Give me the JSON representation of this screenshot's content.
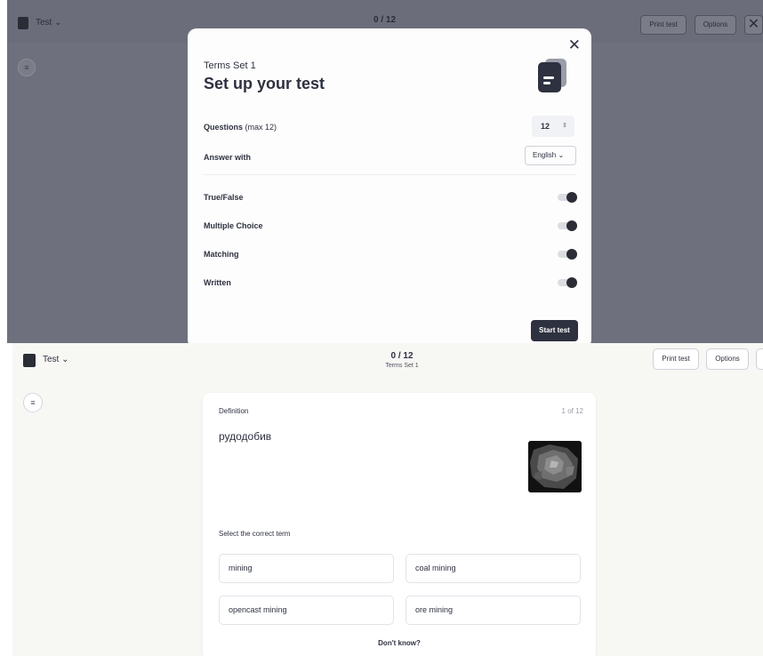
{
  "top": {
    "header": {
      "app_label": "Test ⌄",
      "counter": "0 / 12",
      "print_label": "Print test",
      "options_label": "Options",
      "close_glyph": "✕"
    },
    "modal": {
      "close_glyph": "✕",
      "set_name": "Terms Set 1",
      "title": "Set up your test",
      "questions_label": "Questions",
      "questions_hint": "(max 12)",
      "questions_value": "12",
      "answer_with_label": "Answer with",
      "answer_with_value": "English ⌄",
      "toggles": [
        {
          "label": "True/False",
          "on": true
        },
        {
          "label": "Multiple Choice",
          "on": true
        },
        {
          "label": "Matching",
          "on": true
        },
        {
          "label": "Written",
          "on": true
        }
      ],
      "start_label": "Start test"
    }
  },
  "bottom": {
    "header": {
      "app_label": "Test ⌄",
      "counter": "0 / 12",
      "set_name": "Terms Set 1",
      "print_label": "Print test",
      "options_label": "Options"
    },
    "card": {
      "label": "Definition",
      "progress": "1 of 12",
      "definition": "рудодобив",
      "select_label": "Select the correct term",
      "options": [
        "mining",
        "coal mining",
        "opencast mining",
        "ore mining"
      ],
      "dont_know": "Don't know?"
    }
  }
}
